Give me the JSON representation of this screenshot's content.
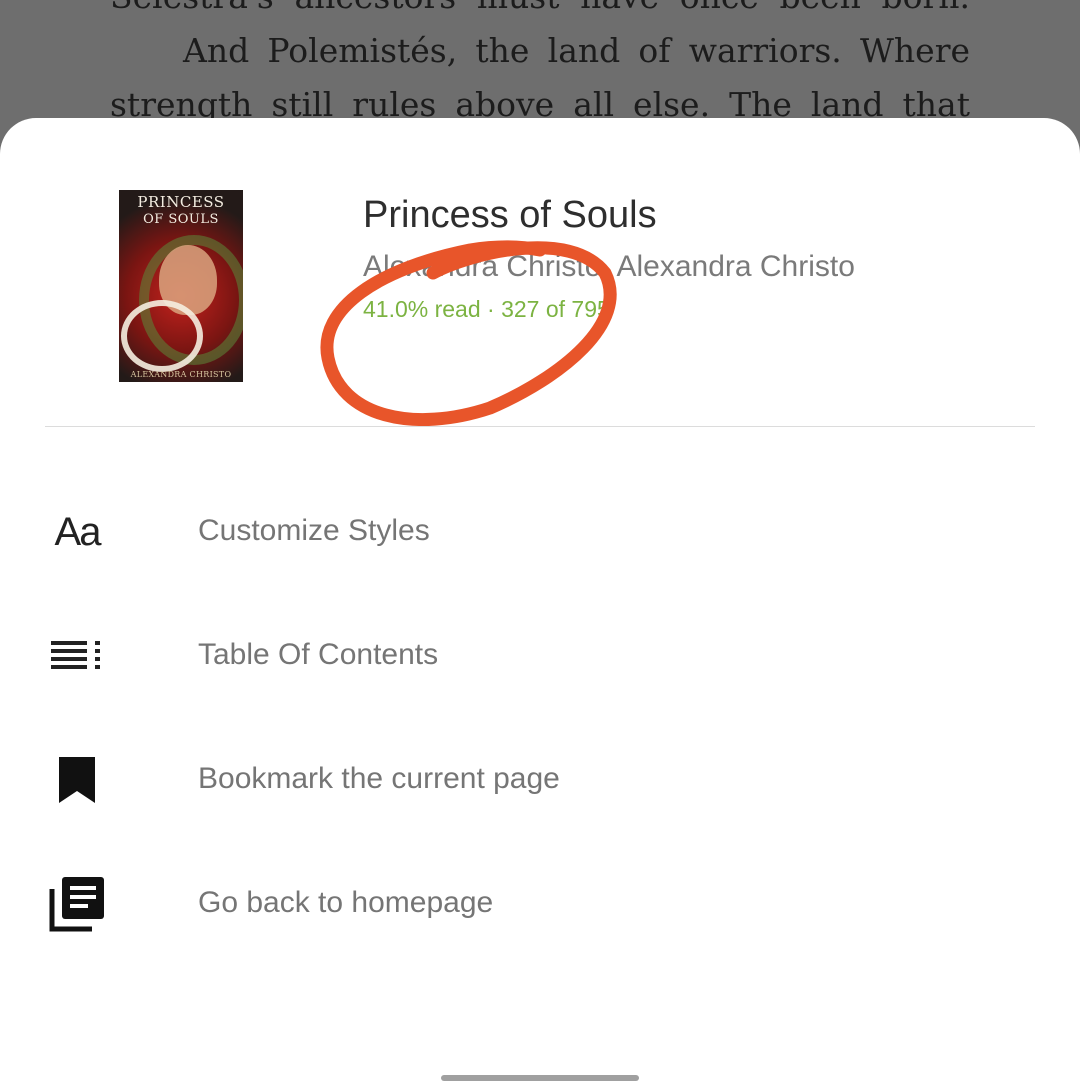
{
  "reader": {
    "lines": [
      "Selestra's ancestors must have once been born.",
      "And Polemistés, the land of warriors. Where",
      "strength still rules above all else. The land that"
    ]
  },
  "book": {
    "cover": {
      "title_line1": "PRINCESS",
      "title_line2": "OF SOULS",
      "author": "ALEXANDRA CHRISTO"
    },
    "title": "Princess of Souls",
    "authors": "Alexandra Christo, Alexandra Christo",
    "progress": "41.0% read · 327 of 795"
  },
  "menu": {
    "items": [
      {
        "label": "Customize Styles",
        "icon": "text-format-icon",
        "icon_text": "Aa"
      },
      {
        "label": "Table Of Contents",
        "icon": "table-of-contents-icon"
      },
      {
        "label": "Bookmark the current page",
        "icon": "bookmark-icon"
      },
      {
        "label": "Go back to homepage",
        "icon": "library-icon"
      }
    ]
  },
  "colors": {
    "progress": "#7cb342",
    "annotation": "#e8552a",
    "overlay": "#6e6e6e"
  }
}
